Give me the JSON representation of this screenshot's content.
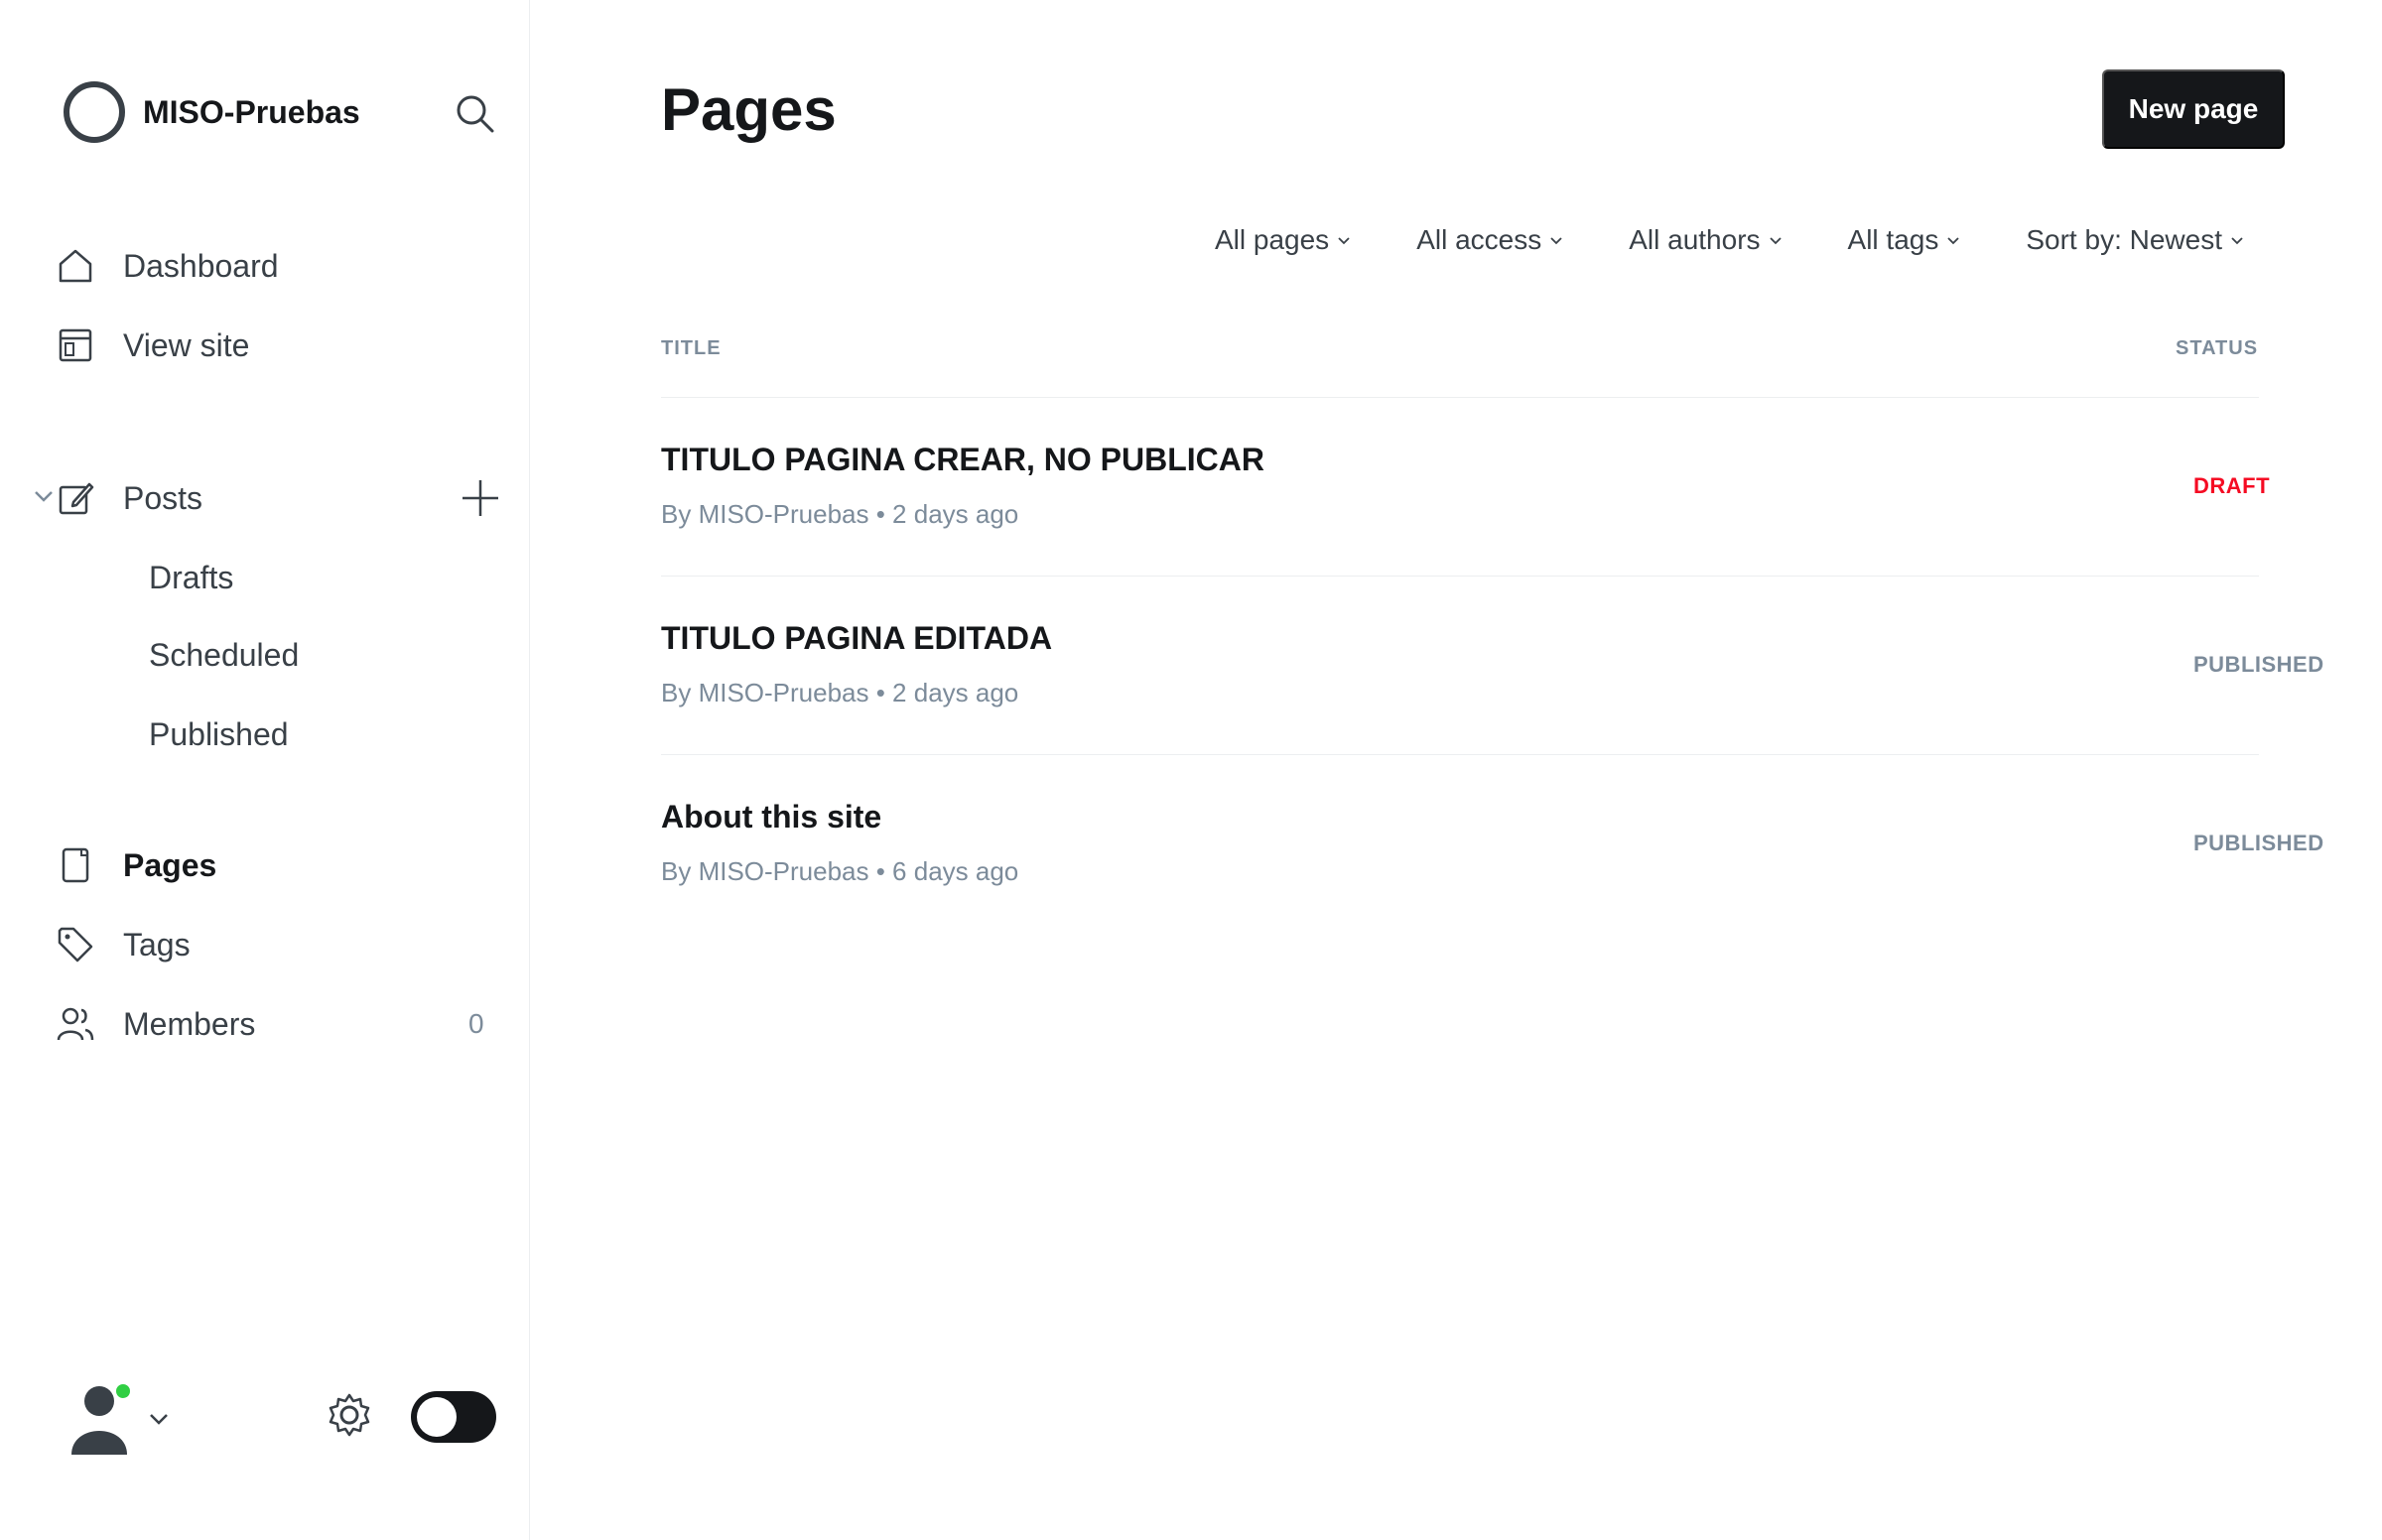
{
  "brand": {
    "name": "MISO-Pruebas"
  },
  "nav": {
    "dashboard": "Dashboard",
    "view_site": "View site",
    "posts": "Posts",
    "drafts": "Drafts",
    "scheduled": "Scheduled",
    "published": "Published",
    "pages": "Pages",
    "tags": "Tags",
    "members": "Members",
    "members_count": "0"
  },
  "header": {
    "title": "Pages",
    "new_page": "New page"
  },
  "filters": [
    "All pages",
    "All access",
    "All authors",
    "All tags",
    "Sort by: Newest"
  ],
  "list": {
    "col_title": "TITLE",
    "col_status": "STATUS",
    "rows": [
      {
        "title": "TITULO PAGINA CREAR, NO PUBLICAR",
        "meta": "By MISO-Pruebas • 2 days ago",
        "status": "DRAFT"
      },
      {
        "title": "TITULO PAGINA EDITADA",
        "meta": "By MISO-Pruebas • 2 days ago",
        "status": "PUBLISHED"
      },
      {
        "title": "About this site",
        "meta": "By MISO-Pruebas • 6 days ago",
        "status": "PUBLISHED"
      }
    ]
  },
  "colors": {
    "accent": "#15171a",
    "draft": "#f50b23",
    "online": "#30cf43"
  }
}
